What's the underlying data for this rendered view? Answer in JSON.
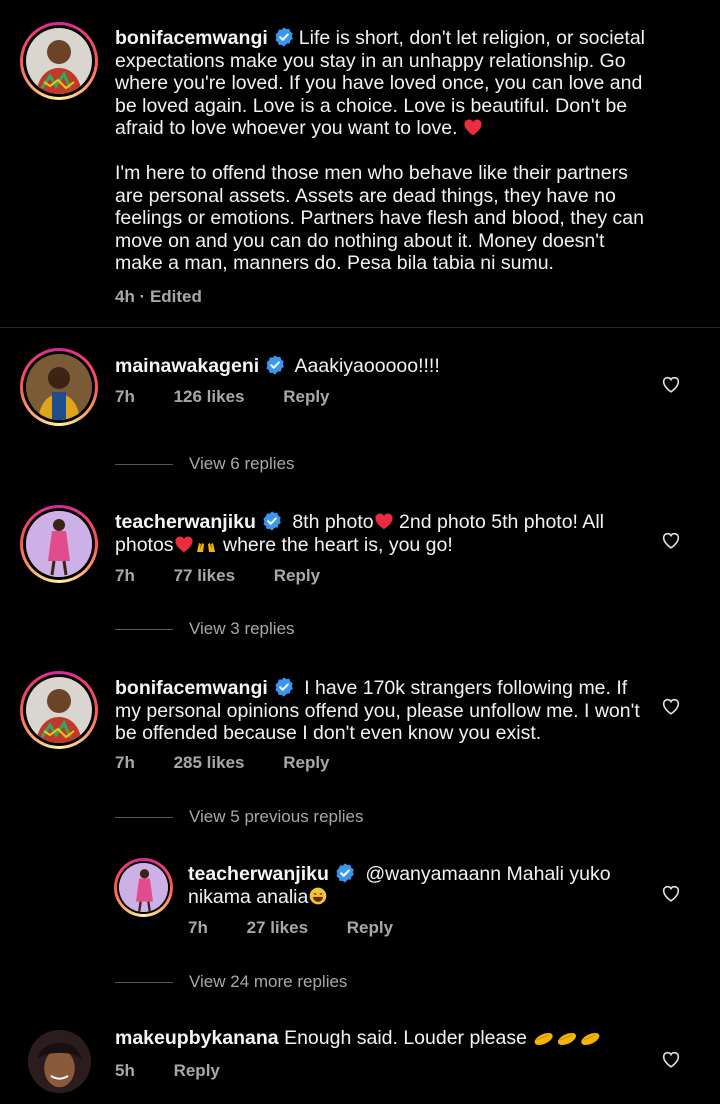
{
  "caption": {
    "username": "bonifacemwangi",
    "text_p1": "Life is short, don't let religion, or societal expectations make you stay in an unhappy relationship. Go where you're loved. If you have loved once, you can love and be loved again. Love is a choice. Love is beautiful. Don't be afraid to love whoever you want to love.",
    "text_p2": "I'm here to offend those men who behave like their partners are personal assets. Assets are dead things, they have no feelings or emotions. Partners have flesh and blood, they can move on and you can do nothing about it. Money doesn't make a man, manners do. Pesa bila tabia ni sumu.",
    "meta": "4h · Edited"
  },
  "comments": [
    {
      "username": "mainawakageni",
      "text": "Aaakiyaooooo!!!!",
      "time": "7h",
      "likes": "126 likes",
      "reply": "Reply",
      "view_replies": "View 6 replies"
    },
    {
      "username": "teacherwanjiku",
      "text_a": "8th photo",
      "text_b": " 2nd photo 5th photo! All photos",
      "text_c": " where the heart is, you go!",
      "time": "7h",
      "likes": "77 likes",
      "reply": "Reply",
      "view_replies": "View 3 replies"
    },
    {
      "username": "bonifacemwangi",
      "text": "I have 170k strangers following me. If my personal opinions offend you, please unfollow me. I won't be offended because I don't even know you exist.",
      "time": "7h",
      "likes": "285 likes",
      "reply": "Reply",
      "view_replies": "View 5 previous replies"
    },
    {
      "username": "teacherwanjiku",
      "text": "@wanyamaann Mahali yuko nikama analia",
      "time": "7h",
      "likes": "27 likes",
      "reply": "Reply",
      "view_replies": "View 24 more replies"
    },
    {
      "username": "makeupbykanana",
      "text": "Enough said. Louder please",
      "time": "5h",
      "reply": "Reply"
    }
  ],
  "colors": {
    "background": "#000000",
    "verified": "#3897f0",
    "secondary_text": "#a8a8a8",
    "heart_red": "#ed4956"
  }
}
